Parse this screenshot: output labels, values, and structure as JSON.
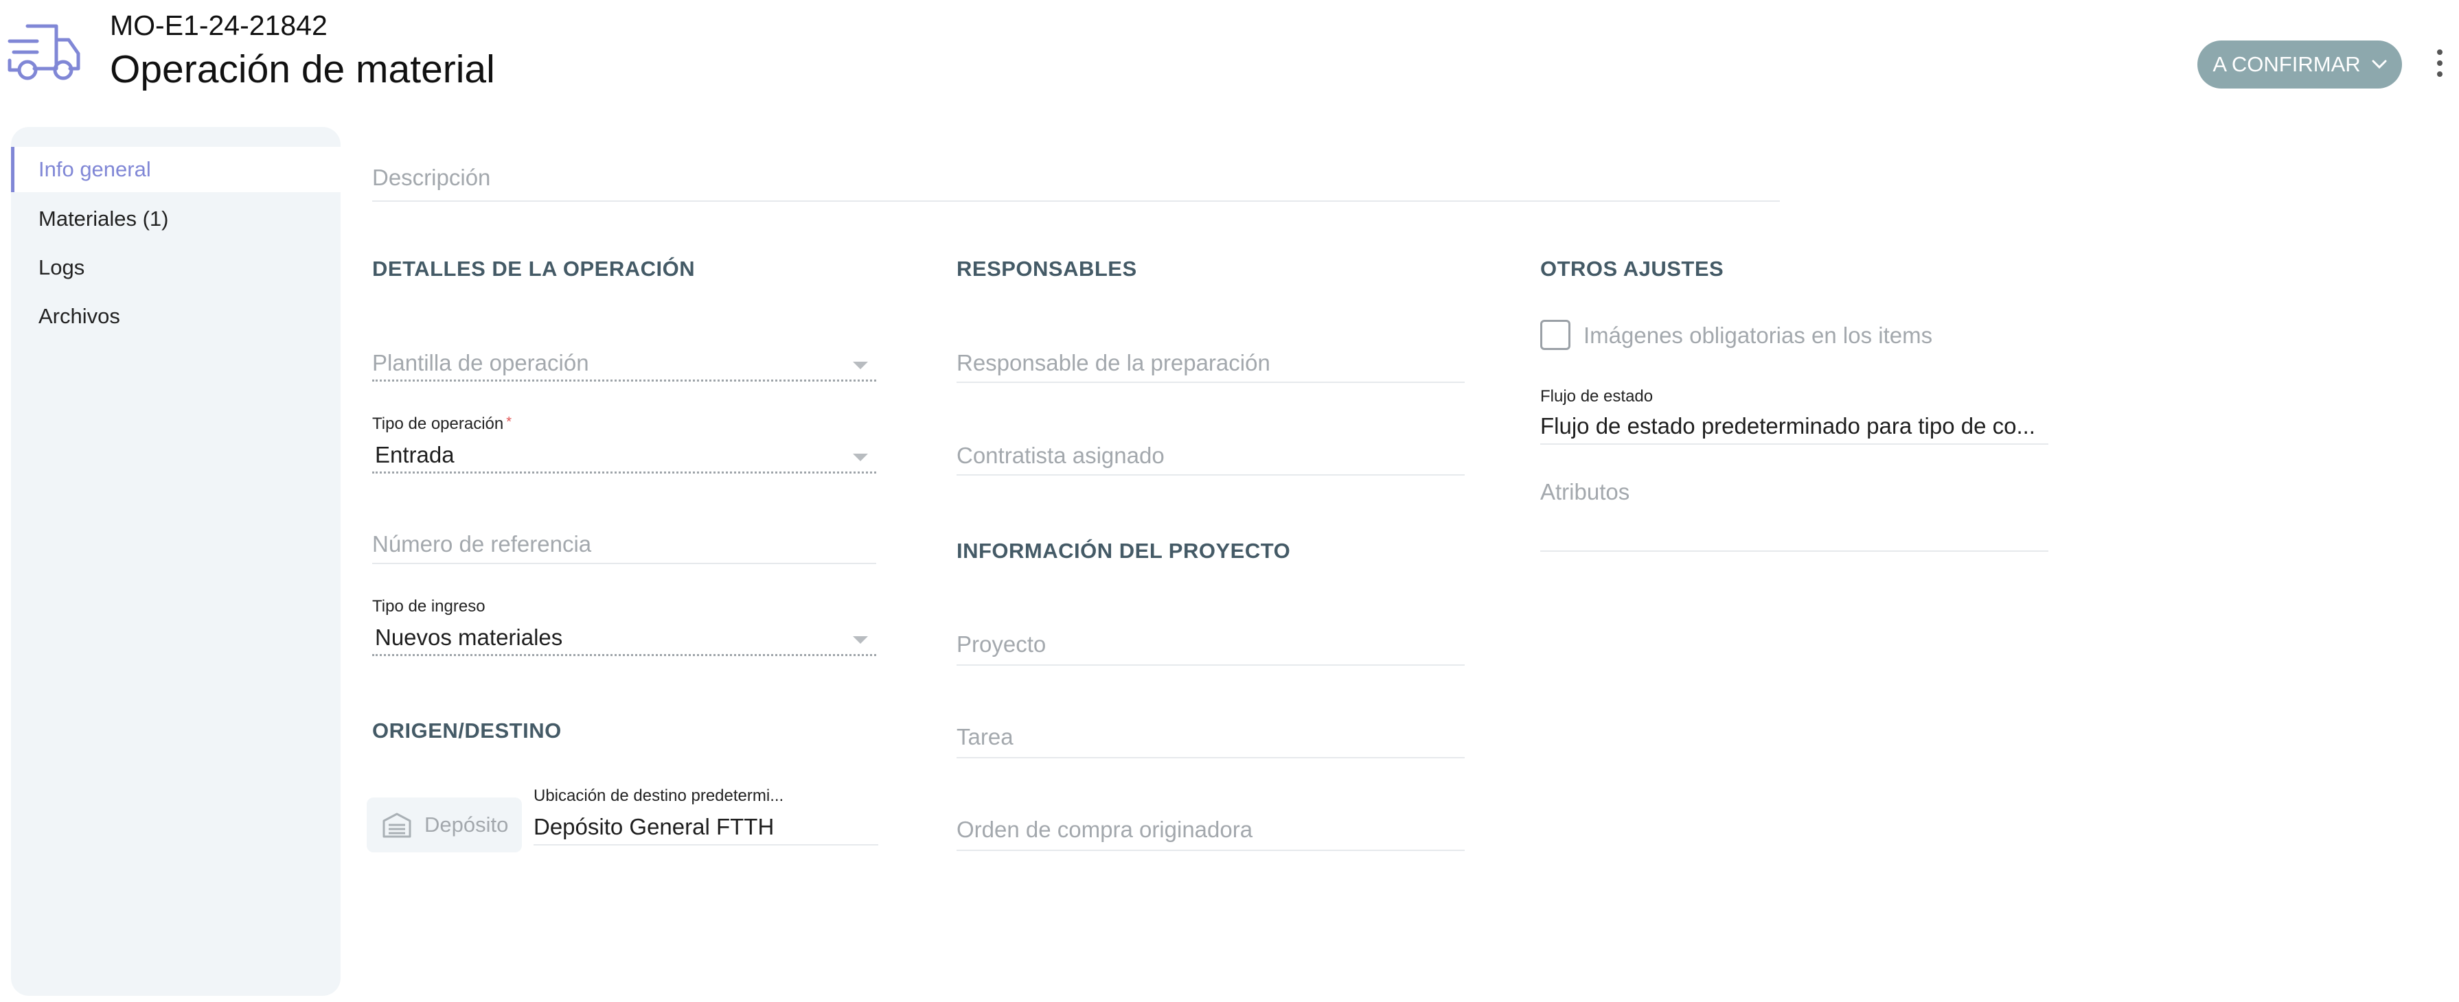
{
  "header": {
    "icon": "truck-icon",
    "doc_id": "MO-E1-24-21842",
    "title": "Operación de material",
    "status_button": "A CONFIRMAR",
    "status_color": "#8da8ad"
  },
  "sidebar": {
    "items": [
      {
        "label": "Info general",
        "active": true
      },
      {
        "label": "Materiales (1)",
        "active": false
      },
      {
        "label": "Logs",
        "active": false
      },
      {
        "label": "Archivos",
        "active": false
      }
    ],
    "accent": "#8087d6"
  },
  "form": {
    "description_placeholder": "Descripción",
    "details": {
      "heading": "DETALLES DE LA OPERACIÓN",
      "template_placeholder": "Plantilla de operación",
      "op_type_label": "Tipo de operación",
      "op_type_required": "*",
      "op_type_value": "Entrada",
      "reference_placeholder": "Número de referencia",
      "income_type_label": "Tipo de ingreso",
      "income_type_value": "Nuevos materiales"
    },
    "origin": {
      "heading": "ORIGEN/DESTINO",
      "warehouse_chip": "Depósito",
      "destination_label": "Ubicación de destino predetermi...",
      "destination_value": "Depósito General FTTH"
    },
    "responsibles": {
      "heading": "RESPONSABLES",
      "prep_placeholder": "Responsable de la preparación",
      "contractor_placeholder": "Contratista asignado"
    },
    "project": {
      "heading": "INFORMACIÓN DEL PROYECTO",
      "project_placeholder": "Proyecto",
      "task_placeholder": "Tarea",
      "po_placeholder": "Orden de compra originadora"
    },
    "other": {
      "heading": "OTROS AJUSTES",
      "images_checkbox": "Imágenes obligatorias en los items",
      "images_checked": false,
      "flow_label": "Flujo de estado",
      "flow_value": "Flujo de estado predeterminado para tipo de co...",
      "attributes_placeholder": "Atributos"
    }
  }
}
